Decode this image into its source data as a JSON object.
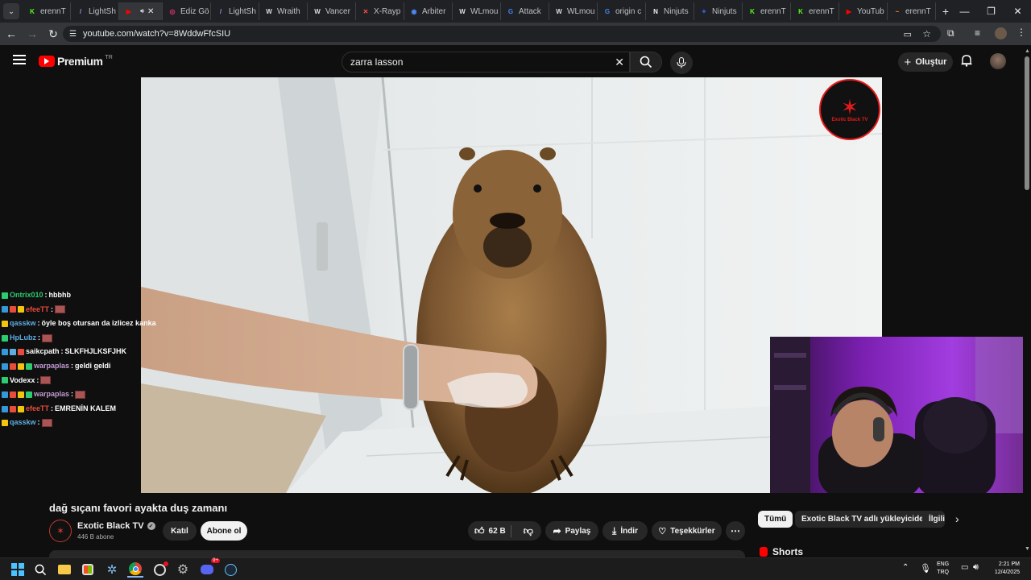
{
  "browser": {
    "tabs": [
      {
        "label": "erennT",
        "color": "#53fc18",
        "glyph": "K"
      },
      {
        "label": "LightSh",
        "color": "#a78bfa",
        "glyph": "/"
      },
      {
        "label": "",
        "color": "#ff0000",
        "glyph": "▶",
        "active": true
      },
      {
        "label": "Ediz Gö",
        "color": "#e1306c",
        "glyph": "◎"
      },
      {
        "label": "LightSh",
        "color": "#a78bfa",
        "glyph": "/"
      },
      {
        "label": "Wraith",
        "color": "#ddd",
        "glyph": "W"
      },
      {
        "label": "Vancer",
        "color": "#ddd",
        "glyph": "W"
      },
      {
        "label": "X-Rayp",
        "color": "#ff4d4d",
        "glyph": "✕"
      },
      {
        "label": "Arbiter",
        "color": "#4c8bf5",
        "glyph": "◉"
      },
      {
        "label": "WLmou",
        "color": "#ddd",
        "glyph": "W"
      },
      {
        "label": "Attack",
        "color": "#4285f4",
        "glyph": "G"
      },
      {
        "label": "WLmou",
        "color": "#ddd",
        "glyph": "W"
      },
      {
        "label": "origin c",
        "color": "#4285f4",
        "glyph": "G"
      },
      {
        "label": "Ninjuts",
        "color": "#eee",
        "glyph": "N"
      },
      {
        "label": "Ninjuts",
        "color": "#3b5bdb",
        "glyph": "✦"
      },
      {
        "label": "erennT",
        "color": "#53fc18",
        "glyph": "K"
      },
      {
        "label": "erennT",
        "color": "#53fc18",
        "glyph": "K"
      },
      {
        "label": "YouTub",
        "color": "#ff0000",
        "glyph": "▶"
      },
      {
        "label": "erennT",
        "color": "#ff8c00",
        "glyph": "~"
      }
    ],
    "url": "youtube.com/watch?v=8WddwFfcSIU"
  },
  "yt": {
    "logo": "Premium",
    "region": "TR",
    "search_value": "zarra lasson",
    "create_label": "Oluştur"
  },
  "chat": [
    {
      "user": "Ontrix010",
      "color": "#2ecc71",
      "msg": "hbbhb",
      "emote": false,
      "badges": [
        "#2ecc71"
      ]
    },
    {
      "user": "efeeTT",
      "color": "#e74c3c",
      "msg": "",
      "emote": true,
      "badges": [
        "#3498db",
        "#e74c3c",
        "#f1c40f"
      ]
    },
    {
      "user": "qasskw",
      "color": "#5dade2",
      "msg": "öyle boş otursan da izlicez kanka",
      "emote": false,
      "badges": [
        "#f1c40f"
      ]
    },
    {
      "user": "HpLubz",
      "color": "#5dade2",
      "msg": "",
      "emote": true,
      "badges": [
        "#2ecc71"
      ]
    },
    {
      "user": "saikcpath",
      "color": "#ffffff",
      "msg": "SLKFHJLKSFJHK",
      "emote": false,
      "badges": [
        "#3498db",
        "#5dade2",
        "#e74c3c"
      ]
    },
    {
      "user": "warpaplas",
      "color": "#c39bd3",
      "msg": "geldi geldi",
      "emote": false,
      "badges": [
        "#3498db",
        "#e74c3c",
        "#f1c40f",
        "#2ecc71"
      ]
    },
    {
      "user": "Vodexx",
      "color": "#ffffff",
      "msg": "",
      "emote": true,
      "badges": [
        "#2ecc71"
      ]
    },
    {
      "user": "warpaplas",
      "color": "#c39bd3",
      "msg": "",
      "emote": true,
      "badges": [
        "#3498db",
        "#e74c3c",
        "#f1c40f",
        "#2ecc71"
      ]
    },
    {
      "user": "efeeTT",
      "color": "#e74c3c",
      "msg": "EMRENİN KALEM",
      "emote": false,
      "badges": [
        "#3498db",
        "#e74c3c",
        "#f1c40f"
      ]
    },
    {
      "user": "qasskw",
      "color": "#5dade2",
      "msg": "",
      "emote": true,
      "badges": [
        "#f1c40f"
      ]
    }
  ],
  "video": {
    "title": "dağ sıçanı favori ayakta duş zamanı",
    "watermark_text": "Exotic Black TV"
  },
  "channel": {
    "name": "Exotic Black TV",
    "subs": "446 B abone",
    "join_label": "Katıl",
    "subscribe_label": "Abone ol"
  },
  "actions": {
    "likes": "62 B",
    "share": "Paylaş",
    "download": "İndir",
    "thanks": "Teşekkürler"
  },
  "chips": [
    "Tümü",
    "Exotic Black TV adlı yükleyiciden",
    "İlgili"
  ],
  "shorts_label": "Shorts",
  "taskbar": {
    "lang_top": "ENG",
    "lang_bottom": "TRQ",
    "time": "2:21 PM",
    "date": "12/4/2025",
    "discord_badge": "9+"
  },
  "colors": {
    "brand_red": "#ff0000",
    "background": "#0f0f0f",
    "chip_active": "#f1f1f1"
  }
}
